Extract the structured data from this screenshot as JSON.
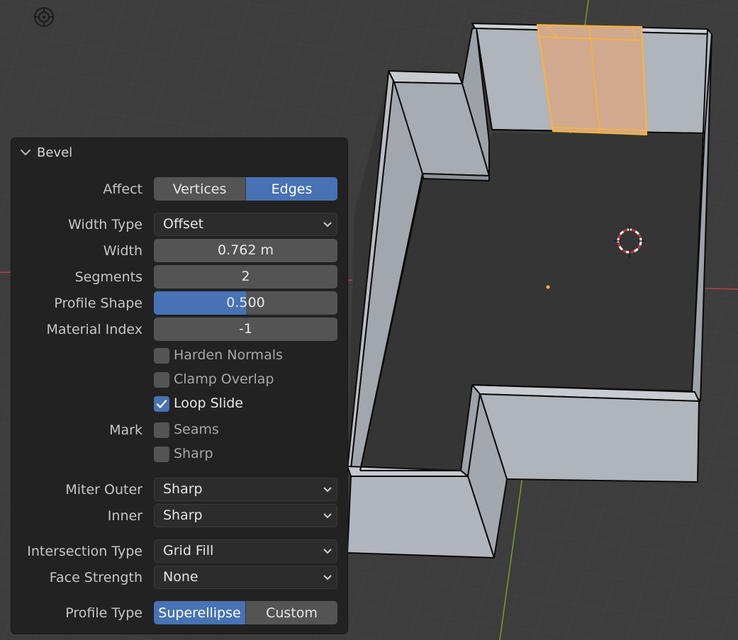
{
  "panel": {
    "title": "Bevel",
    "affect": {
      "label": "Affect",
      "options": [
        "Vertices",
        "Edges"
      ],
      "selected": "Edges"
    },
    "width_type": {
      "label": "Width Type",
      "value": "Offset"
    },
    "width": {
      "label": "Width",
      "value": "0.762 m"
    },
    "segments": {
      "label": "Segments",
      "value": "2"
    },
    "profile_shape": {
      "label": "Profile Shape",
      "value": "0.500",
      "fraction": 0.5
    },
    "material_index": {
      "label": "Material Index",
      "value": "-1"
    },
    "harden_normals": {
      "label": "Harden Normals",
      "checked": false
    },
    "clamp_overlap": {
      "label": "Clamp Overlap",
      "checked": false
    },
    "loop_slide": {
      "label": "Loop Slide",
      "checked": true
    },
    "mark": {
      "label": "Mark",
      "seams": {
        "label": "Seams",
        "checked": false
      },
      "sharp": {
        "label": "Sharp",
        "checked": false
      }
    },
    "miter_outer": {
      "label": "Miter Outer",
      "value": "Sharp"
    },
    "miter_inner": {
      "label": "Inner",
      "value": "Sharp"
    },
    "intersection_type": {
      "label": "Intersection Type",
      "value": "Grid Fill"
    },
    "face_strength": {
      "label": "Face Strength",
      "value": "None"
    },
    "profile_type": {
      "label": "Profile Type",
      "options": [
        "Superellipse",
        "Custom"
      ],
      "selected": "Superellipse"
    }
  },
  "icons": {
    "header_chevron": "chevron-down-icon",
    "dropdown_arrow": "chevron-down-icon",
    "checkbox": "checkmark-icon",
    "view_gizmo": "view-navigation-icon",
    "cursor": "3d-cursor-icon"
  },
  "colors": {
    "accent": "#4772b3",
    "selection": "#ffb42e",
    "selected_face": "#d1a98f",
    "viewport_bg": "#3d3d3d",
    "panel_bg": "#222222",
    "mesh": "#a7abb2",
    "x_axis": "#b54249",
    "y_axis": "#7a9c2e"
  }
}
